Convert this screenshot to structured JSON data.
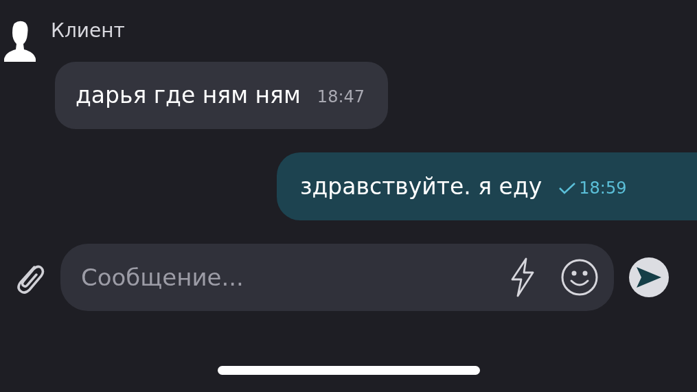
{
  "messages": [
    {
      "kind": "incoming",
      "sender": "Клиент",
      "text": "дарья где ням ням",
      "time": "18:47"
    },
    {
      "kind": "outgoing",
      "text": "здравствуйте. я еду",
      "time": "18:59",
      "delivered": true
    }
  ],
  "composer": {
    "placeholder": "Сообщение..."
  }
}
